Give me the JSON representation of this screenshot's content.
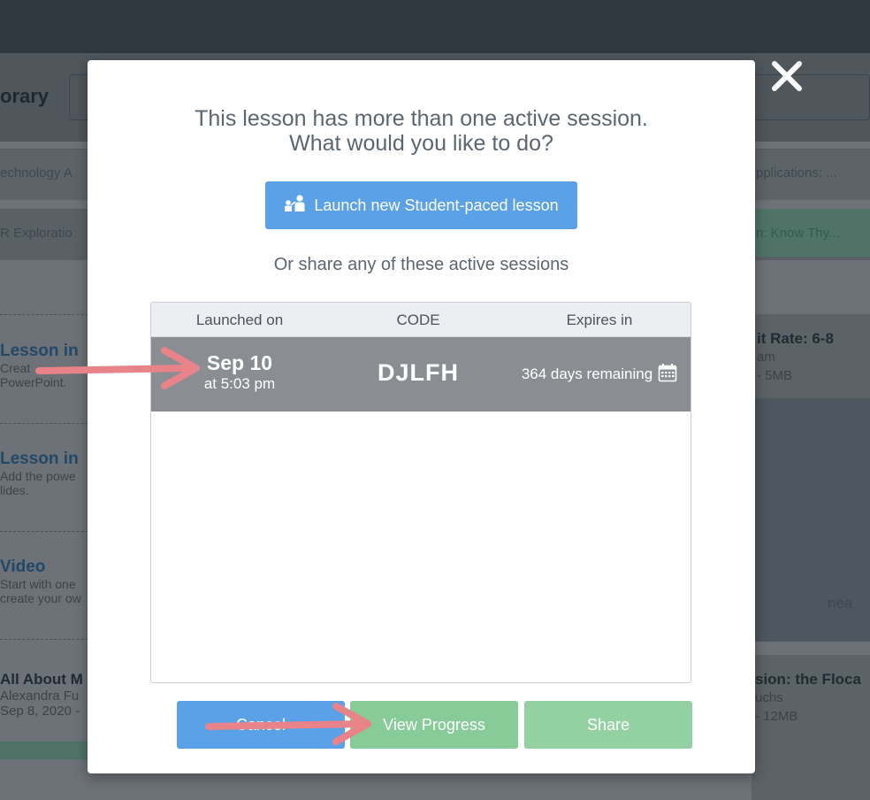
{
  "background": {
    "library_title": "orary",
    "filter_left": "echnology A",
    "filter_right": "pplications: ...",
    "row2_left": "R Exploratio",
    "row2_right": "n: Know Thy...",
    "list": [
      {
        "title": "Lesson in",
        "line1": "Creat",
        "line2": "PowerPoint."
      },
      {
        "title": "Lesson in",
        "line1": "Add the powe",
        "line2": "lides."
      },
      {
        "title": "Video",
        "line1": "Start with one",
        "line2": "create your ow"
      }
    ],
    "card_right": {
      "title": "it Rate: 6-8",
      "line1": "am",
      "line2": "- 5MB",
      "brand": "nea"
    },
    "bottom_left": {
      "title": "All About M",
      "line1": "Alexandra Fu",
      "line2": "Sep 8, 2020 -"
    },
    "bottom_right": {
      "title": "sion: the Floca",
      "line1": "uchs",
      "line2": "- 12MB"
    }
  },
  "modal": {
    "title_line1": "This lesson has more than one active session.",
    "title_line2": "What would you like to do?",
    "launch_button": "Launch new Student-paced lesson",
    "share_heading": "Or share any of these active sessions",
    "table": {
      "headers": [
        "Launched on",
        "CODE",
        "Expires in"
      ],
      "rows": [
        {
          "date": "Sep 10",
          "time": "at 5:03 pm",
          "code": "DJLFH",
          "expires": "364 days remaining"
        }
      ]
    },
    "buttons": {
      "cancel": "Cancel",
      "view_progress": "View Progress",
      "share": "Share"
    }
  },
  "colors": {
    "primary_blue": "#5aa1e8",
    "green": "#86cb98",
    "selected_row": "#8a8e92",
    "annotation_arrow": "#e8838a"
  },
  "icons": [
    "close-icon",
    "teacher-student-icon",
    "calendar-icon"
  ]
}
